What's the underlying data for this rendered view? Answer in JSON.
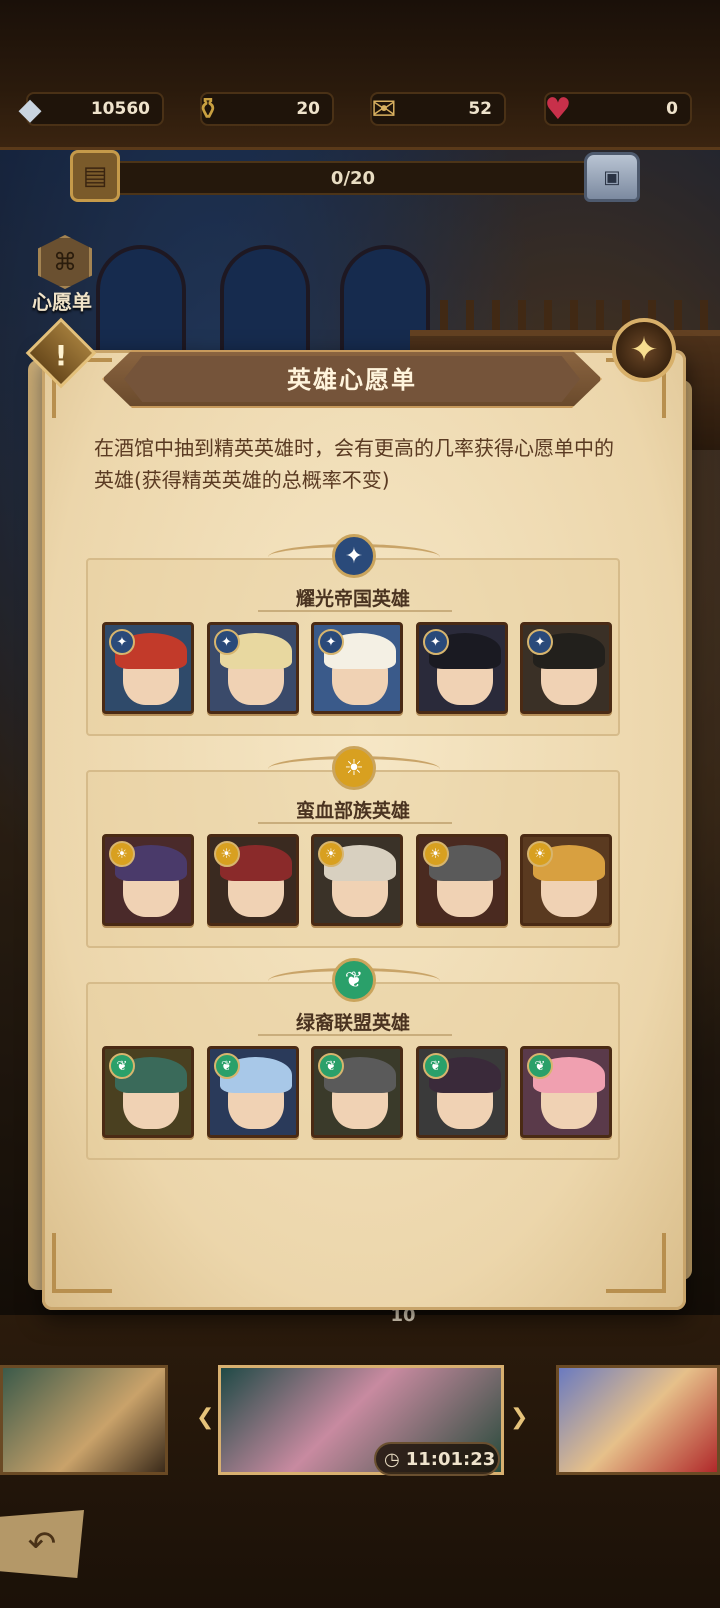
{
  "resources": [
    {
      "icon": "diamond-icon",
      "value": "10560"
    },
    {
      "icon": "scroll-icon",
      "value": "20"
    },
    {
      "icon": "bag-scroll-icon",
      "value": "52"
    },
    {
      "icon": "heart-icon",
      "value": "0"
    }
  ],
  "progress": {
    "text": "0/20",
    "current": 0,
    "max": 20
  },
  "side_button": {
    "label": "心愿单"
  },
  "modal": {
    "title": "英雄心愿单",
    "description": "在酒馆中抽到精英英雄时，会有更高的几率获得心愿单中的英雄(获得精英英雄的总概率不变)",
    "factions": [
      {
        "name": "耀光帝国英雄",
        "emblem_color": "#2a4a7a",
        "heroes": [
          {
            "hair": "#c23a2a",
            "bg": "#2f4a6a"
          },
          {
            "hair": "#e8d8a0",
            "bg": "#3a4a6a"
          },
          {
            "hair": "#f4f0e4",
            "bg": "#3a5a8a"
          },
          {
            "hair": "#1a1a22",
            "bg": "#2a2a3a"
          },
          {
            "hair": "#22201c",
            "bg": "#3a3026"
          }
        ]
      },
      {
        "name": "蛮血部族英雄",
        "emblem_color": "#d8a020",
        "heroes": [
          {
            "hair": "#4a3a6a",
            "bg": "#4a2a2a"
          },
          {
            "hair": "#8a2a2a",
            "bg": "#3a2a20"
          },
          {
            "hair": "#d8d0c0",
            "bg": "#3a3228"
          },
          {
            "hair": "#5a5a5a",
            "bg": "#4a2a20"
          },
          {
            "hair": "#d8a040",
            "bg": "#5a3a20"
          }
        ]
      },
      {
        "name": "绿裔联盟英雄",
        "emblem_color": "#2aa06a",
        "heroes": [
          {
            "hair": "#3a6a5a",
            "bg": "#4a4020"
          },
          {
            "hair": "#a8c8e8",
            "bg": "#2a3a5a"
          },
          {
            "hair": "#5a5a5a",
            "bg": "#3a3a2a"
          },
          {
            "hair": "#3a2a3a",
            "bg": "#3a3a3a"
          },
          {
            "hair": "#f0a0b0",
            "bg": "#5a3a4a"
          }
        ]
      }
    ]
  },
  "behind_modal_number": "10",
  "timer": {
    "text": "11:01:23"
  },
  "colors": {
    "accent_gold": "#d8b06a",
    "parchment": "#f0dcb4"
  }
}
